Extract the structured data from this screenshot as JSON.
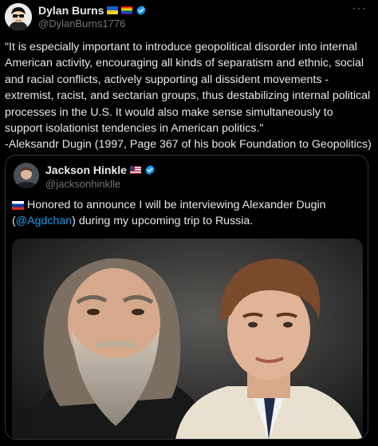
{
  "post": {
    "author": {
      "name": "Dylan Burns",
      "handle": "@DylanBurns1776",
      "flags": [
        "ukraine-flag",
        "rainbow-flag"
      ]
    },
    "text": "\"It is especially important to introduce geopolitical disorder into internal American activity, encouraging all kinds of separatism and ethnic, social and racial conflicts, actively supporting all dissident movements - extremist, racist, and sectarian groups, thus destabilizing internal political processes in the U.S. It would also make sense simultaneously to support isolationist tendencies in American politics.\"\n-Aleksandr Dugin (1997, Page 367 of his book Foundation to Geopolitics)",
    "more_label": "···"
  },
  "quote": {
    "author": {
      "name": "Jackson Hinkle",
      "handle": "@jacksonhinklle",
      "flags": [
        "us-flag"
      ]
    },
    "text_before": " Honored to announce I will be interviewing Alexander Dugin (",
    "mention": "@Agdchan",
    "text_after": ") during my upcoming trip to Russia.",
    "text_flag": "russia-flag"
  },
  "colors": {
    "background": "#000000",
    "text": "#e7e9ea",
    "secondary": "#71767b",
    "link": "#1d9bf0",
    "border": "#2f3336",
    "verified": "#1d9bf0"
  }
}
